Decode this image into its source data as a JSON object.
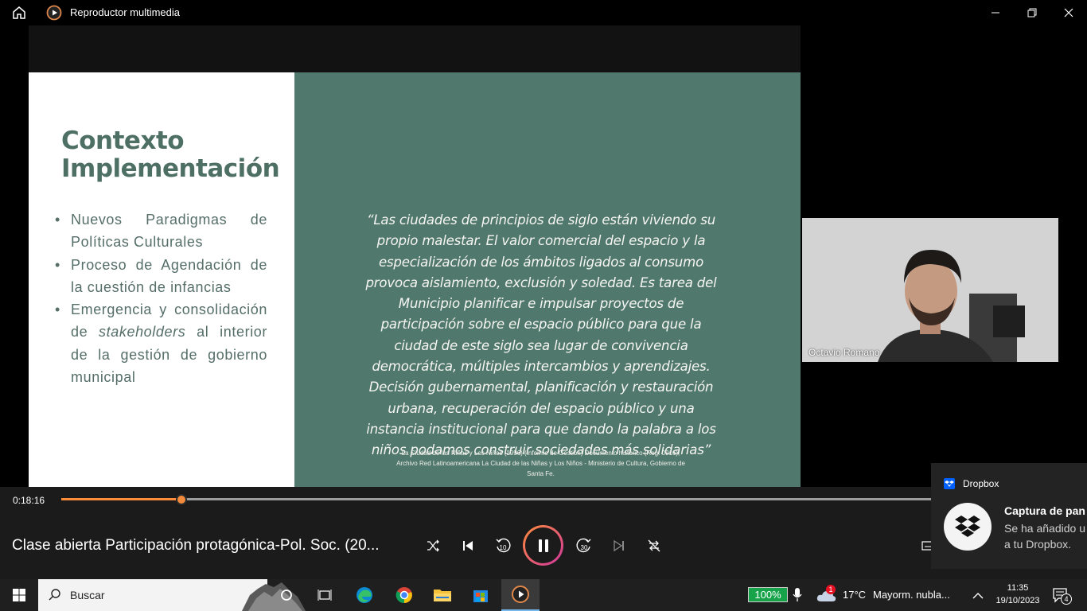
{
  "window": {
    "title": "Reproductor multimedia"
  },
  "slide": {
    "title_line1": "Contexto",
    "title_line2": "Implementación",
    "bullets": {
      "b1": "Nuevos Paradigmas de Políticas Culturales",
      "b2": "Proceso de Agendación de la cuestión de infancias",
      "b3_pre": "Emergencia y consolidación de ",
      "b3_em": "stakeholders",
      "b3_post": " al interior de la gestión de gobierno municipal"
    },
    "quote": "“Las ciudades de principios de siglo están viviendo su propio malestar. El valor comercial del espacio y la especialización de los ámbitos ligados al consumo provoca aislamiento, exclusión y soledad. Es tarea del Municipio planificar e impulsar proyectos de participación sobre el espacio público para que la ciudad de este siglo sea lugar de convivencia democrática, múltiples intercambios y aprendizajes. Decisión gubernamental, planificación y restauración urbana, recuperación del espacio público y una instancia institucional para que dando la palabra a los niños podamos construir sociedades más solidarias”",
    "citation": "La Ciudad de las Niñas y Los Niños (1996) (Informe de Gestión) Documento histórico (Reg. 0016), Archivo Red Latinoamericana La Ciudad de las Niñas y Los Niños - Ministerio de Cultura, Gobierno de Santa Fe."
  },
  "webcam": {
    "name": "Octavio Romano"
  },
  "player": {
    "elapsed": "0:18:16",
    "progress": 0.137,
    "media_title": "Clase abierta Participación protagónica-Pol. Soc. (20...",
    "rewind_label": "10",
    "forward_label": "30"
  },
  "toast": {
    "app": "Dropbox",
    "title": "Captura de pan",
    "body_line1": "Se ha añadido u",
    "body_line2": "a tu Dropbox."
  },
  "taskbar": {
    "search_placeholder": "Buscar",
    "battery": "100%",
    "weather_badge": "1",
    "temperature": "17°C",
    "weather_desc": "Mayorm. nubla...",
    "time": "11:35",
    "date": "19/10/2023",
    "notifications": "4"
  },
  "colors": {
    "accent_orange": "#ff8c3a",
    "slide_green": "#51786c",
    "title_green": "#4d6f64"
  }
}
